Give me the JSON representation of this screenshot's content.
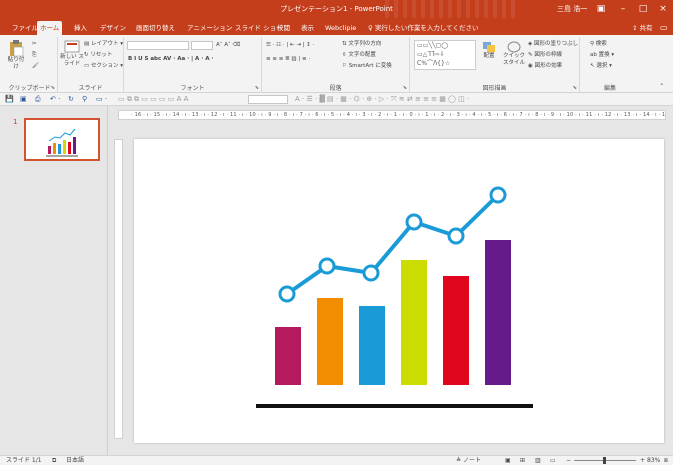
{
  "window": {
    "title": "プレゼンテーション1 - PowerPoint",
    "user": "三島 浩一"
  },
  "tabs": [
    "ファイル",
    "ホーム",
    "挿入",
    "デザイン",
    "画面切り替え",
    "アニメーション",
    "スライド ショー",
    "校閲",
    "表示",
    "Webclipie"
  ],
  "active_tab": "ホーム",
  "tell_me": "実行したい作業を入力してください",
  "share": "共有",
  "ribbon": {
    "clipboard": {
      "label": "クリップボード",
      "paste": "貼り付け"
    },
    "slides": {
      "label": "スライド",
      "new_slide": "新しい スライド",
      "layout": "レイアウト",
      "reset": "リセット",
      "section": "セクション"
    },
    "font": {
      "label": "フォント"
    },
    "paragraph": {
      "label": "段落",
      "text_direction": "文字列の方向",
      "align_text": "文字の配置",
      "smartart": "SmartArt に変換"
    },
    "drawing": {
      "label": "図形描画",
      "arrange": "配置",
      "quick_styles": "クイック スタイル",
      "shape_fill": "図形の塗りつぶし",
      "shape_outline": "図形の枠線",
      "shape_effects": "図形の効果"
    },
    "editing": {
      "label": "編集",
      "find": "検索",
      "replace": "置換",
      "select": "選択"
    }
  },
  "slide_panel": {
    "slide_number": "1"
  },
  "ruler": {
    "horizontal": "· 16 · ı · 15 · ı · 14 · ı · 13 · ı · 12 · ı · 11 · ı · 10 · ı · 9 · ı · 8 · ı · 7 · ı · 6 · ı · 5 · ı · 4 · ı · 3 · ı · 2 · ı · 1 · ı · 0 · ı · 1 · ı · 2 · ı · 3 · ı · 4 · ı · 5 · ı · 6 · ı · 7 · ı · 8 · ı · 9 · ı · 10 · ı · 11 · ı · 12 · ı · 13 · ı · 14 · ı · 15 · ı · 16 ·"
  },
  "status": {
    "slide": "スライド 1/1",
    "language": "日本語",
    "notes": "ノート",
    "zoom": "83%"
  },
  "chart_graphic": {
    "bar_colors": [
      "#b5195e",
      "#f28c00",
      "#1a9bd7",
      "#cddc00",
      "#e1061e",
      "#651c8a"
    ],
    "line_color": "#1a9bd7",
    "baseline_color": "#111111",
    "title_bar_color": "#c43e1c"
  }
}
